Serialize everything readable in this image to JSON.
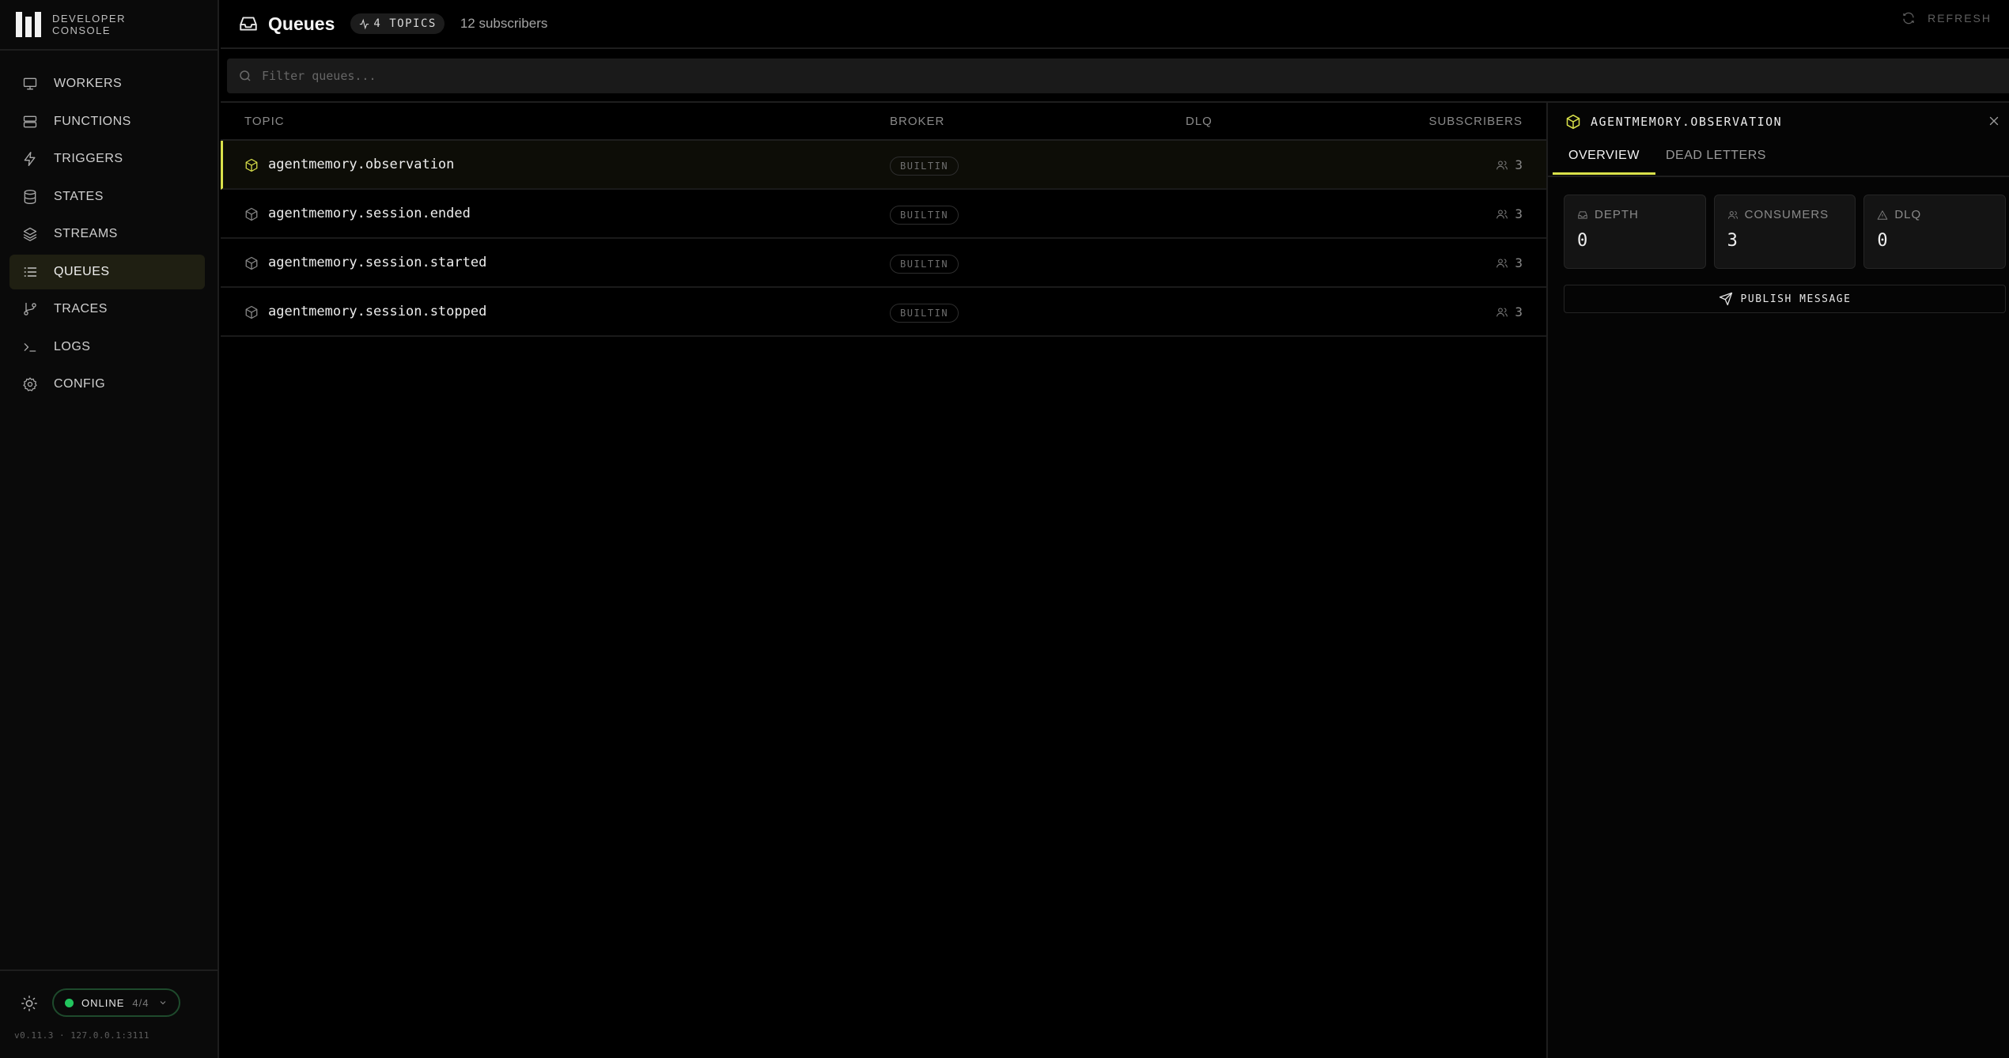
{
  "brand": {
    "line1": "DEVELOPER",
    "line2": "CONSOLE"
  },
  "sidebar": {
    "items": [
      {
        "label": "WORKERS",
        "icon": "monitor-icon"
      },
      {
        "label": "FUNCTIONS",
        "icon": "server-icon"
      },
      {
        "label": "TRIGGERS",
        "icon": "zap-icon"
      },
      {
        "label": "STATES",
        "icon": "database-icon"
      },
      {
        "label": "STREAMS",
        "icon": "layers-icon"
      },
      {
        "label": "QUEUES",
        "icon": "list-icon",
        "active": true
      },
      {
        "label": "TRACES",
        "icon": "git-branch-icon"
      },
      {
        "label": "LOGS",
        "icon": "terminal-icon"
      },
      {
        "label": "CONFIG",
        "icon": "gear-icon"
      }
    ],
    "status": {
      "label": "ONLINE",
      "count": "4/4",
      "color": "#22c55e"
    },
    "version": "v0.11.3 · 127.0.0.1:3111"
  },
  "header": {
    "title": "Queues",
    "topics_badge": "4 TOPICS",
    "subscribers": "12 subscribers",
    "refresh_label": "REFRESH"
  },
  "filter": {
    "placeholder": "Filter queues..."
  },
  "table": {
    "columns": {
      "topic": "TOPIC",
      "broker": "BROKER",
      "dlq": "DLQ",
      "subscribers": "SUBSCRIBERS"
    },
    "rows": [
      {
        "topic": "agentmemory.observation",
        "broker": "BUILTIN",
        "dlq": "",
        "subscribers": "3",
        "selected": true
      },
      {
        "topic": "agentmemory.session.ended",
        "broker": "BUILTIN",
        "dlq": "",
        "subscribers": "3"
      },
      {
        "topic": "agentmemory.session.started",
        "broker": "BUILTIN",
        "dlq": "",
        "subscribers": "3"
      },
      {
        "topic": "agentmemory.session.stopped",
        "broker": "BUILTIN",
        "dlq": "",
        "subscribers": "3"
      }
    ]
  },
  "detail": {
    "title": "AGENTMEMORY.OBSERVATION",
    "tabs": {
      "overview": "OVERVIEW",
      "dead_letters": "DEAD LETTERS"
    },
    "stats": {
      "depth": {
        "label": "DEPTH",
        "value": "0"
      },
      "consumers": {
        "label": "CONSUMERS",
        "value": "3"
      },
      "dlq": {
        "label": "DLQ",
        "value": "0"
      }
    },
    "publish_label": "PUBLISH MESSAGE"
  },
  "colors": {
    "accent": "#d9e14a",
    "online": "#22c55e",
    "background": "#000000"
  }
}
